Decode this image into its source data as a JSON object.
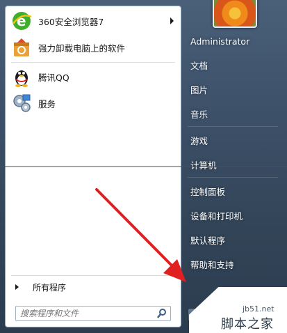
{
  "programs": [
    {
      "label": "360安全浏览器7",
      "icon": "browser-360-icon",
      "has_submenu": true
    },
    {
      "label": "强力卸载电脑上的软件",
      "icon": "uninstall-box-icon",
      "has_submenu": false
    },
    {
      "label": "腾讯QQ",
      "icon": "qq-penguin-icon",
      "has_submenu": false
    },
    {
      "label": "服务",
      "icon": "services-gears-icon",
      "has_submenu": false
    }
  ],
  "all_programs": "所有程序",
  "search": {
    "placeholder": "搜索程序和文件"
  },
  "right_menu": {
    "user": "Administrator",
    "items": [
      "文档",
      "图片",
      "音乐",
      "游戏",
      "计算机",
      "控制面板",
      "设备和打印机",
      "默认程序",
      "帮助和支持"
    ]
  },
  "watermark": {
    "url": "jb51.net",
    "name": "脚本之家"
  },
  "colors": {
    "accent_line": "#d4141a",
    "arrow": "#e02020",
    "panel_bg": "#3c5068"
  }
}
